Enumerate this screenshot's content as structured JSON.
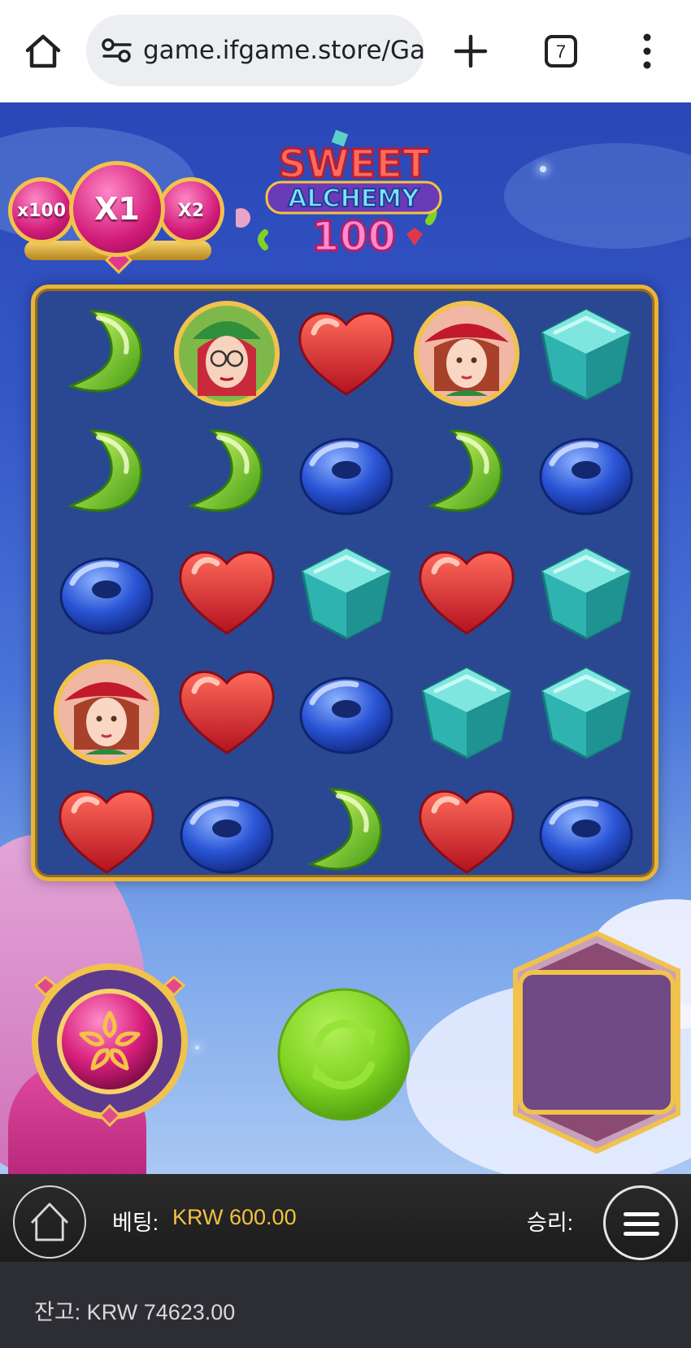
{
  "browser": {
    "url": "game.ifgame.store/Gar",
    "tab_count": "7",
    "icons": [
      "home-icon",
      "site-settings-icon",
      "new-tab-plus-icon",
      "tab-switcher-icon",
      "more-vert-icon"
    ]
  },
  "game": {
    "logo": {
      "line1": "SWEET",
      "line2": "ALCHEMY",
      "line3": "100"
    },
    "multipliers": [
      {
        "label": "x100",
        "active": false
      },
      {
        "label": "X1",
        "active": true
      },
      {
        "label": "X2",
        "active": false
      }
    ],
    "board": {
      "rows": 5,
      "cols": 5,
      "grid": [
        [
          "green-crescent",
          "witch-glasses",
          "red-heart",
          "witch-red",
          "teal-cube"
        ],
        [
          "green-crescent",
          "green-crescent",
          "blue-ring",
          "green-crescent",
          "blue-ring"
        ],
        [
          "blue-ring",
          "red-heart",
          "teal-cube",
          "red-heart",
          "teal-cube"
        ],
        [
          "witch-red",
          "red-heart",
          "blue-ring",
          "teal-cube",
          "teal-cube"
        ],
        [
          "red-heart",
          "blue-ring",
          "green-crescent",
          "red-heart",
          "blue-ring"
        ]
      ]
    },
    "controls": {
      "buy_feature_icon": "star-flower-icon",
      "spin_icon": "refresh-icon",
      "win_panel_value": ""
    }
  },
  "status_bar": {
    "bet_label": "베팅:",
    "bet_value": "KRW 600.00",
    "win_label": "승리:",
    "balance_text": "잔고: KRW 74623.00"
  },
  "colors": {
    "bet_value": "#f3c240",
    "frame_gold": "#e8b53a",
    "board_bg": "#2a4891",
    "spin_green": "#7fd321"
  }
}
